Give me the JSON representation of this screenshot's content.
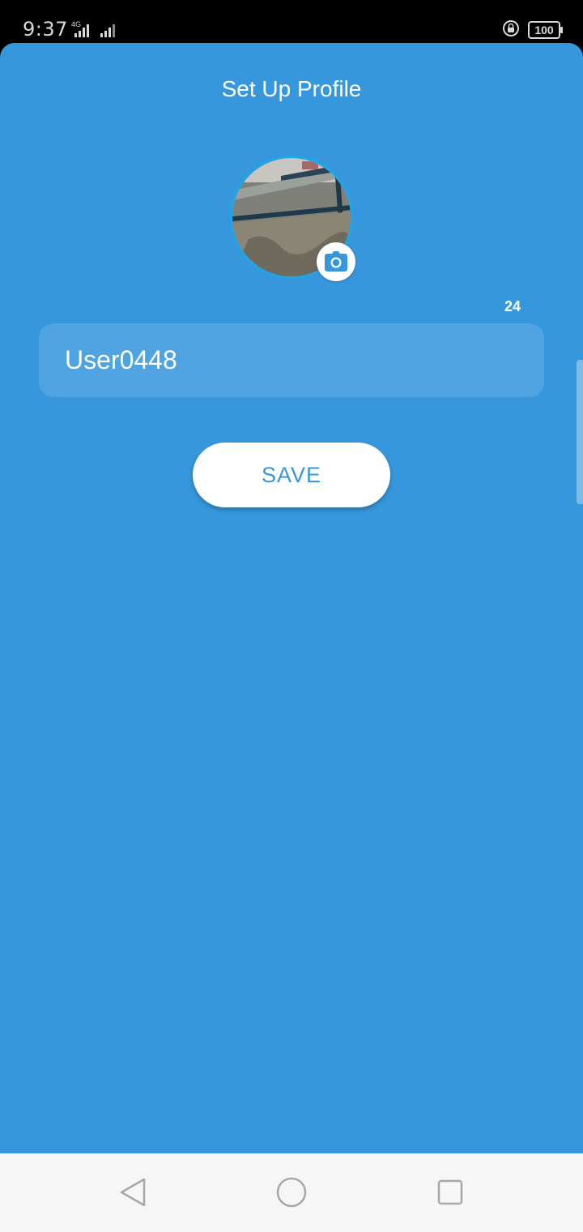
{
  "status_bar": {
    "time": "9:37",
    "network": "4G",
    "battery": "100"
  },
  "page": {
    "title": "Set Up Profile"
  },
  "profile": {
    "avatar_icon": "profile-photo",
    "camera_icon": "camera-icon"
  },
  "name_input": {
    "char_counter": "24",
    "value": "User0448"
  },
  "actions": {
    "save_label": "SAVE"
  },
  "colors": {
    "primary": "#3797dc",
    "button_bg": "#ffffff",
    "status_bar": "#000000",
    "nav_bar": "#f6f6f6"
  },
  "navigation": {
    "back_icon": "back-triangle-icon",
    "home_icon": "home-circle-icon",
    "recents_icon": "recents-square-icon"
  }
}
